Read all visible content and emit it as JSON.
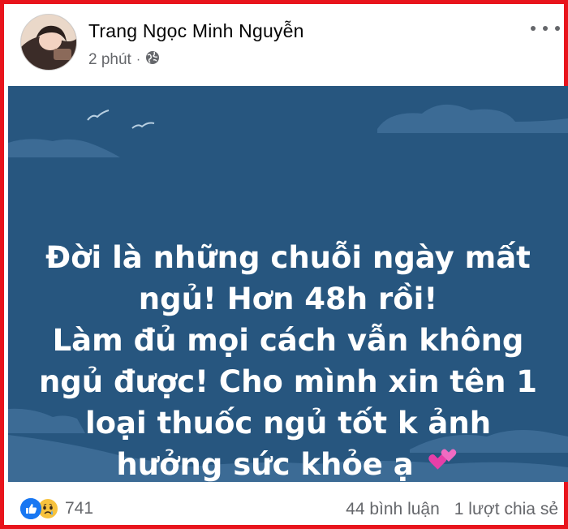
{
  "author": {
    "name": "Trang Ngọc Minh Nguyễn"
  },
  "meta": {
    "time": "2 phút",
    "separator": "·",
    "audience_icon": "globe-icon"
  },
  "menu_icon": "more-options-icon",
  "post": {
    "background_color": "#27567f",
    "lines": [
      "Đời là những chuỗi ngày mất",
      "ngủ! Hơn 48h rồi!",
      "Làm đủ mọi cách vẫn không",
      "ngủ được! Cho mình xin tên 1",
      "loại thuốc ngủ tốt k ảnh",
      "hưởng sức khỏe ạ"
    ],
    "emoji": "two-hearts-icon"
  },
  "footer": {
    "reaction_icons": [
      "like-icon",
      "sad-icon"
    ],
    "reaction_count": "741",
    "comments": "44 bình luận",
    "shares": "1 lượt chia sẻ"
  }
}
